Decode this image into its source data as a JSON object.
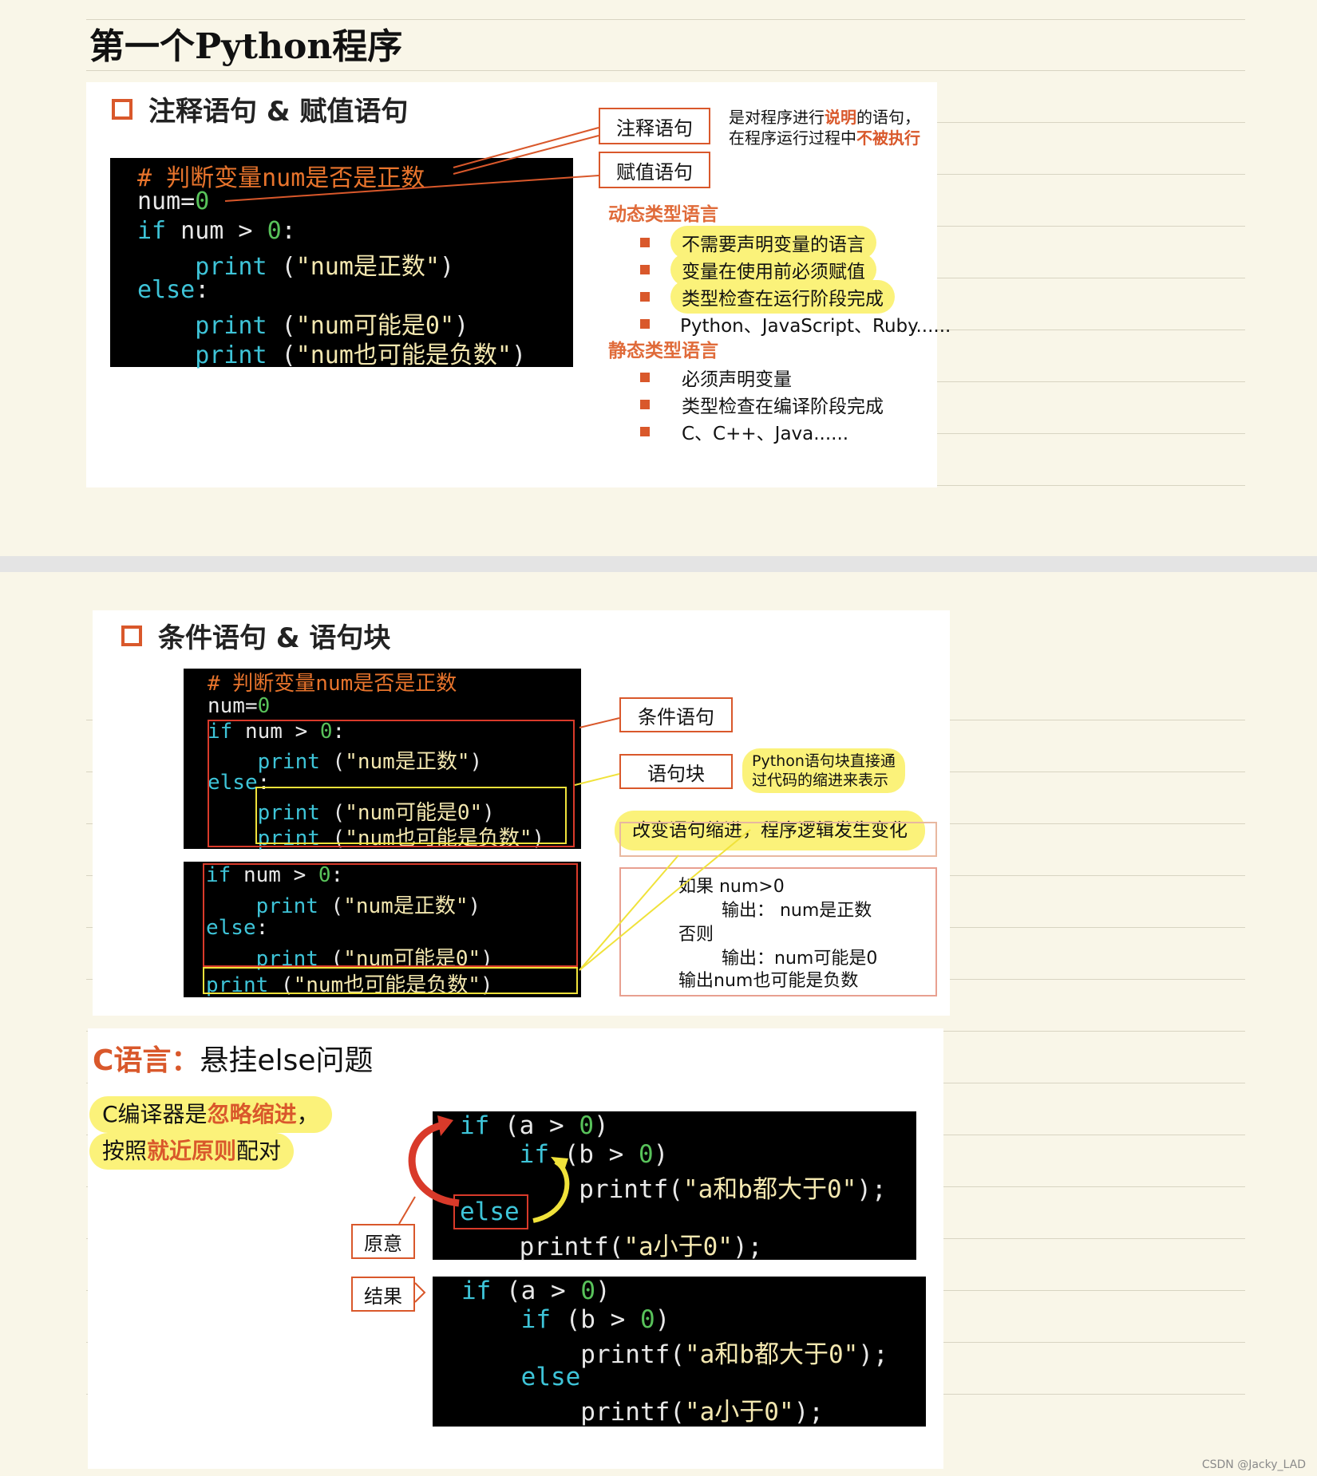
{
  "page": {
    "title": "第一个Python程序",
    "watermark": "CSDN @Jacky_LAD"
  },
  "slide1": {
    "heading": "注释语句 & 赋值语句",
    "code": [
      "# 判断变量num是否是正数",
      "num=0",
      "if num > 0:",
      "    print (\"num是正数\")",
      "else:",
      "    print (\"num可能是0\")",
      "    print (\"num也可能是负数\")"
    ],
    "comment_tag": "注释语句",
    "assign_tag": "赋值语句",
    "comment_note_1a": "是对程序进行",
    "comment_note_1b": "说明",
    "comment_note_1c": "的语句，",
    "comment_note_2a": "在程序运行过程中",
    "comment_note_2b": "不被执行",
    "dynamic_title": "动态类型语言",
    "dynamic_items": [
      "不需要声明变量的语言",
      "变量在使用前必须赋值",
      "类型检查在运行阶段完成",
      "Python、JavaScript、Ruby......"
    ],
    "static_title": "静态类型语言",
    "static_items": [
      "必须声明变量",
      "类型检查在编译阶段完成",
      "C、C++、Java......"
    ]
  },
  "slide2": {
    "heading": "条件语句 & 语句块",
    "code_a": [
      "# 判断变量num是否是正数",
      "num=0",
      "if num > 0:",
      "    print (\"num是正数\")",
      "else:",
      "    print (\"num可能是0\")",
      "    print (\"num也可能是负数\")"
    ],
    "code_b": [
      "if num > 0:",
      "    print (\"num是正数\")",
      "else:",
      "    print (\"num可能是0\")",
      "print (\"num也可能是负数\")"
    ],
    "cond_tag": "条件语句",
    "block_tag": "语句块",
    "block_note_1": "Python语句块直接通",
    "block_note_2": "过代码的缩进来表示",
    "change_note": "改变语句缩进，程序逻辑发生变化",
    "logic_lines": [
      "如果 num>0",
      "输出：  num是正数",
      "否则",
      "输出：num可能是0",
      "输出num也可能是负数"
    ]
  },
  "slide3": {
    "heading_red": "C语言：",
    "heading_rest": "悬挂else问题",
    "note_1a": "C编译器是",
    "note_1b": "忽略缩进",
    "note_1c": "，",
    "note_2a": "按照",
    "note_2b": "就近原则",
    "note_2c": "配对",
    "orig_tag": "原意",
    "result_tag": "结果",
    "code_a": [
      "if (a > 0)",
      "    if (b > 0)",
      "        printf(\"a和b都大于0\");",
      "else",
      "    printf(\"a小于0\");"
    ],
    "code_b": [
      "if (a > 0)",
      "    if (b > 0)",
      "        printf(\"a和b都大于0\");",
      "    else",
      "        printf(\"a小于0\");"
    ]
  },
  "colors": {
    "accent": "#d9582b",
    "highlight": "#fbf27a",
    "keyword": "#3ec4d8",
    "number": "#58c25a",
    "string": "#f4e8b0",
    "comment": "#e8742c"
  }
}
